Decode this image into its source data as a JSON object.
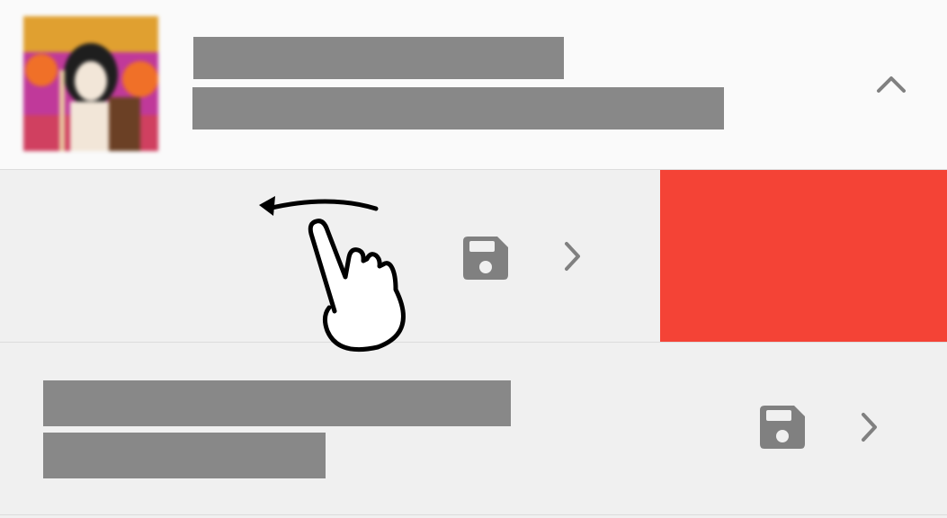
{
  "header": {
    "thumbnail_icon": "album-art-image",
    "title": "",
    "subtitle": "",
    "collapse_icon": "chevron-up-icon"
  },
  "swipe_row": {
    "save_icon": "floppy-disk-icon",
    "open_icon": "chevron-right-icon",
    "action_color": "#f44336"
  },
  "bottom_row": {
    "title": "",
    "subtitle": "",
    "save_icon": "floppy-disk-icon",
    "open_icon": "chevron-right-icon"
  },
  "gesture": {
    "icon": "swipe-left-hand-icon"
  },
  "colors": {
    "placeholder": "#888888",
    "icon": "#808080",
    "delete": "#f44336",
    "row_bg": "#f0f0f0",
    "header_bg": "#fafafa"
  }
}
